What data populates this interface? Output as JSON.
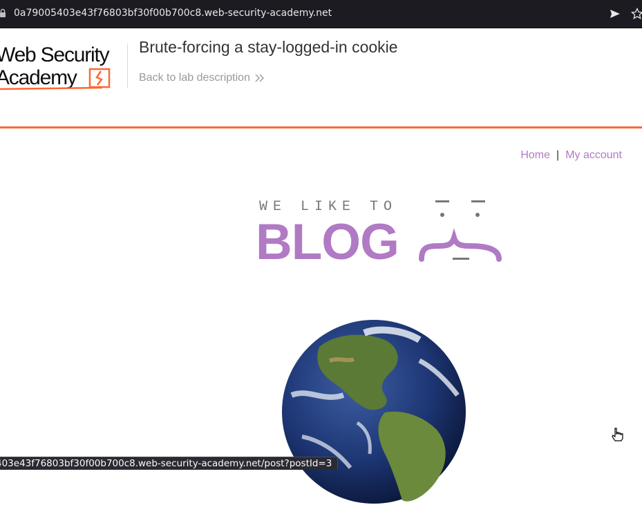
{
  "browser": {
    "url": "0a79005403e43f76803bf30f00b700c8.web-security-academy.net",
    "icons": [
      "lock-icon",
      "send-icon",
      "star-icon"
    ]
  },
  "lab_header": {
    "logo_text_line1": "Web Security",
    "logo_text_line2": "Academy",
    "title": "Brute-forcing a stay-logged-in cookie",
    "back_link": "Back to lab description",
    "accent_color": "#ff6633"
  },
  "nav": {
    "home": "Home",
    "separator": "|",
    "my_account": "My account",
    "link_color": "#b07ac4"
  },
  "blog_logo": {
    "tagline": "WE LIKE TO",
    "word": "BLOG",
    "color": "#b07ac4"
  },
  "status_bar": {
    "link_preview": "403e43f76803bf30f00b700c8.web-security-academy.net/post?postId=3"
  }
}
